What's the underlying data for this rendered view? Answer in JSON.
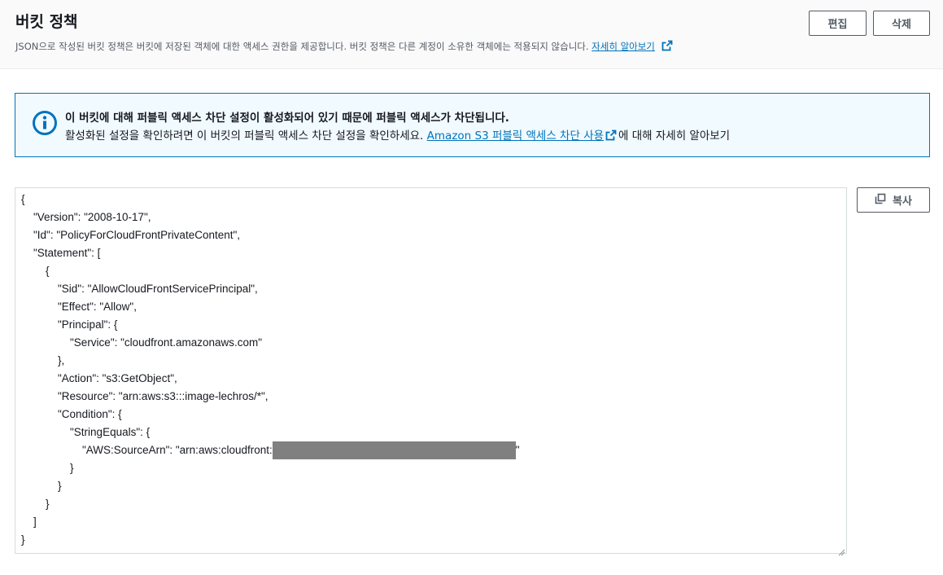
{
  "header": {
    "title": "버킷 정책",
    "description": "JSON으로 작성된 버킷 정책은 버킷에 저장된 객체에 대한 액세스 권한을 제공합니다. 버킷 정책은 다른 계정이 소유한 객체에는 적용되지 않습니다.",
    "learn_more_link": "자세히 알아보기",
    "edit_label": "편집",
    "delete_label": "삭제"
  },
  "alert": {
    "icon": "info-icon",
    "title": "이 버킷에 대해 퍼블릭 액세스 차단 설정이 활성화되어 있기 때문에 퍼블릭 액세스가 차단됩니다.",
    "body_prefix": "활성화된 설정을 확인하려면 이 버킷의 퍼블릭 액세스 차단 설정을 확인하세요.",
    "body_link": "Amazon S3 퍼블릭 액세스 차단 사용",
    "body_suffix": "에 대해 자세히 알아보기"
  },
  "policy": {
    "copy_label": "복사",
    "lines": [
      "{",
      "    \"Version\": \"2008-10-17\",",
      "    \"Id\": \"PolicyForCloudFrontPrivateContent\",",
      "    \"Statement\": [",
      "        {",
      "            \"Sid\": \"AllowCloudFrontServicePrincipal\",",
      "            \"Effect\": \"Allow\",",
      "            \"Principal\": {",
      "                \"Service\": \"cloudfront.amazonaws.com\"",
      "            },",
      "            \"Action\": \"s3:GetObject\",",
      "            \"Resource\": \"arn:aws:s3:::image-lechros/*\",",
      "            \"Condition\": {",
      "                \"StringEquals\": {",
      "                    \"AWS:SourceArn\": \"arn:aws:cloudfront:",
      "                }",
      "            }",
      "        }",
      "    ]",
      "}"
    ],
    "redacted_line_suffix": "\""
  },
  "colors": {
    "link": "#0073bb",
    "alert_border": "#0073bb",
    "alert_bg": "#f1faff",
    "redaction": "#808080"
  }
}
